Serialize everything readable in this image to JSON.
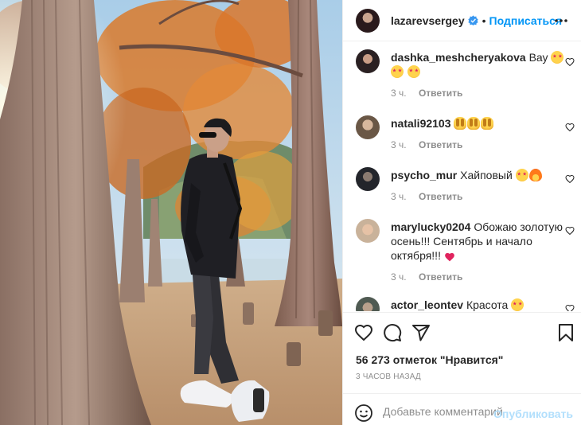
{
  "post": {
    "photo_alt": "photo",
    "author": "lazarevsergey",
    "dot": "•",
    "follow_label": "Подписаться"
  },
  "comments": [
    {
      "user": "dashka_meshcheryakova",
      "text": "Вау",
      "emojis": [
        "starry-eyes-emoji",
        "starry-eyes-emoji",
        "starry-eyes-emoji"
      ],
      "time": "3 ч.",
      "reply": "Ответить"
    },
    {
      "user": "natali92103",
      "text": "",
      "emojis": [
        "raising-hands-emoji",
        "raising-hands-emoji",
        "raising-hands-emoji"
      ],
      "time": "3 ч.",
      "reply": "Ответить"
    },
    {
      "user": "psycho_mur",
      "text": "Хайповый",
      "emojis": [
        "starry-eyes-emoji",
        "fire-emoji"
      ],
      "time": "3 ч.",
      "reply": "Ответить"
    },
    {
      "user": "marylucky0204",
      "text": "Обожаю золотую осень!!! Сентябрь и начало октября!!!",
      "emojis": [
        "red-heart-emoji"
      ],
      "time": "3 ч.",
      "reply": "Ответить"
    },
    {
      "user": "actor_leontev",
      "text": "Красота",
      "emojis": [
        "starry-eyes-emoji"
      ],
      "time": "",
      "reply": ""
    }
  ],
  "stats": {
    "likes_count": "56 273",
    "likes_label": "отметок",
    "likes_action": "\"Нравится\"",
    "time_ago": "3 часов назад"
  },
  "composer": {
    "placeholder": "Добавьте комментарий...",
    "publish_label": "Опубликовать"
  },
  "icons": {
    "like": "heart-icon",
    "comment": "comment-icon",
    "share": "paper-plane-icon",
    "save": "bookmark-icon",
    "emoji": "smiley-icon",
    "more": "ellipsis-icon",
    "verified": "verified-badge-icon"
  },
  "colors": {
    "accent": "#0095f6",
    "publish_disabled": "#b2dffc",
    "muted": "#8e8e8e",
    "text": "#262626"
  }
}
